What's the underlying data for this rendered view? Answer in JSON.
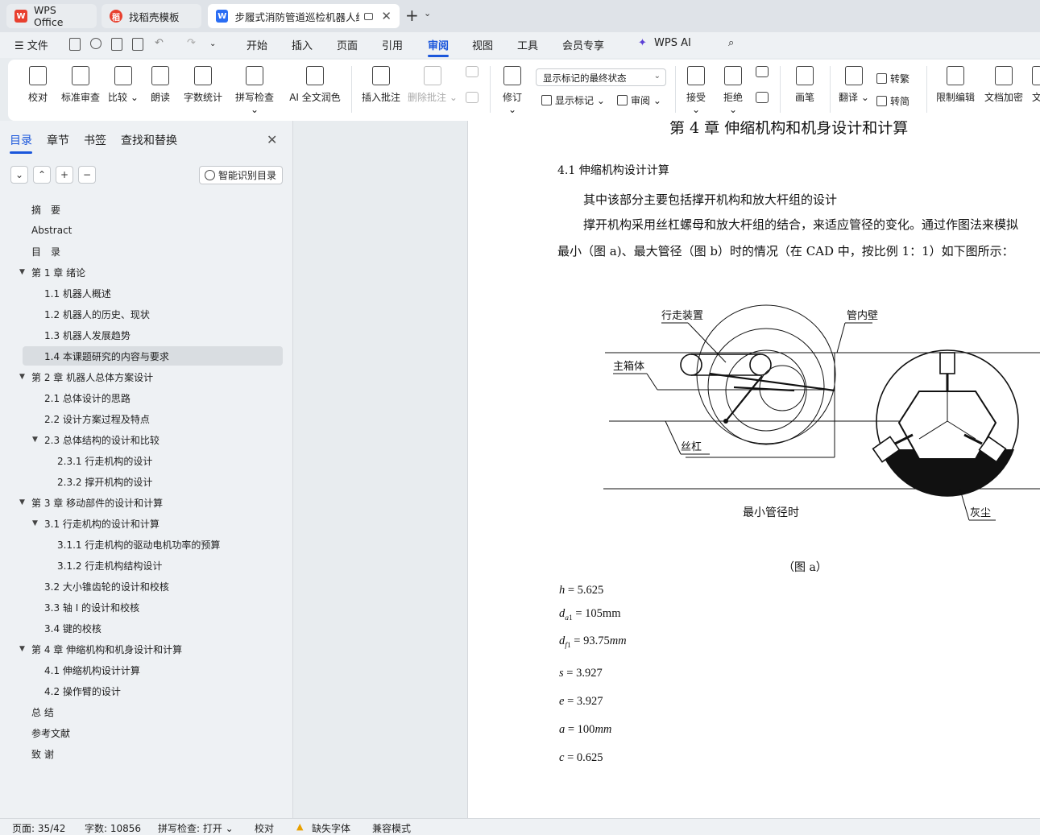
{
  "tabs": [
    {
      "label": "WPS Office"
    },
    {
      "label": "找稻壳模板"
    },
    {
      "label": "步履式消防管道巡检机器人结"
    }
  ],
  "menu": [
    "文件",
    "开始",
    "插入",
    "页面",
    "引用",
    "审阅",
    "视图",
    "工具",
    "会员专享",
    "WPS AI"
  ],
  "menu_active": "审阅",
  "ribbon": {
    "proof": "校对",
    "std_review": "标准审查",
    "compare": "比较",
    "read_aloud": "朗读",
    "word_count": "字数统计",
    "spell_check": "拼写检查",
    "ai_polish": "AI 全文润色",
    "insert_comment": "插入批注",
    "delete_comment": "删除批注",
    "revise": "修订",
    "markup_dropdown": "显示标记的最终状态",
    "show_markup": "显示标记",
    "review": "审阅",
    "accept": "接受",
    "reject": "拒绝",
    "pen": "画笔",
    "translate": "翻译",
    "to_traditional": "转繁",
    "to_simplified": "转简",
    "restrict_edit": "限制编辑",
    "doc_encrypt": "文档加密",
    "doc_cut": "文"
  },
  "sidebar": {
    "tabs": [
      "目录",
      "章节",
      "书签",
      "查找和替换"
    ],
    "smart_toc": "智能识别目录",
    "toc": [
      {
        "label": "摘　要",
        "level": 0
      },
      {
        "label": "Abstract",
        "level": 0
      },
      {
        "label": "目　录",
        "level": 0
      },
      {
        "label": "第 1 章  绪论",
        "level": 0,
        "expanded": true
      },
      {
        "label": "1.1  机器人概述",
        "level": 1
      },
      {
        "label": "1.2  机器人的历史、现状",
        "level": 1
      },
      {
        "label": "1.3 机器人发展趋势",
        "level": 1
      },
      {
        "label": "1.4  本课题研究的内容与要求",
        "level": 1,
        "selected": true
      },
      {
        "label": "第 2 章  机器人总体方案设计",
        "level": 0,
        "expanded": true
      },
      {
        "label": "2.1 总体设计的思路",
        "level": 1
      },
      {
        "label": "2.2  设计方案过程及特点",
        "level": 1
      },
      {
        "label": "2.3  总体结构的设计和比较",
        "level": 1,
        "expanded": true
      },
      {
        "label": "2.3.1  行走机构的设计",
        "level": 2
      },
      {
        "label": "2.3.2  撑开机构的设计",
        "level": 2
      },
      {
        "label": "第 3 章  移动部件的设计和计算",
        "level": 0,
        "expanded": true
      },
      {
        "label": "3.1  行走机构的设计和计算",
        "level": 1,
        "expanded": true
      },
      {
        "label": "3.1.1  行走机构的驱动电机功率的预算",
        "level": 2
      },
      {
        "label": "3.1.2  行走机构结构设计",
        "level": 2
      },
      {
        "label": "3.2 大小锥齿轮的设计和校核",
        "level": 1
      },
      {
        "label": "3.3  轴 I 的设计和校核",
        "level": 1
      },
      {
        "label": "3.4  键的校核",
        "level": 1
      },
      {
        "label": "第 4 章  伸缩机构和机身设计和计算",
        "level": 0,
        "expanded": true
      },
      {
        "label": "4.1  伸缩机构设计计算",
        "level": 1
      },
      {
        "label": "4.2  操作臂的设计",
        "level": 1
      },
      {
        "label": "总 结",
        "level": 0
      },
      {
        "label": "参考文献",
        "level": 0
      },
      {
        "label": "致 谢",
        "level": 0
      }
    ]
  },
  "document": {
    "chapter_title": "第 4 章  伸缩机构和机身设计和计算",
    "section_title": "4.1  伸缩机构设计计算",
    "para1": "其中该部分主要包括撑开机构和放大杆组的设计",
    "para2": "撑开机构采用丝杠螺母和放大杆组的结合，来适应管径的变化。通过作图法来模拟",
    "para3": "最小（图 a)、最大管径（图 b）时的情况（在 CAD 中，按比例 1：1）如下图所示：",
    "figure": {
      "label_walker": "行走装置",
      "label_pipe_wall": "管内壁",
      "label_main_box": "主箱体",
      "label_lead_screw": "丝杠",
      "label_min_diam": "最小管径时",
      "label_dust": "灰尘"
    },
    "figure_caption": "（图 a）",
    "formulas": {
      "h": "= 5.625",
      "da1": "= 105mm",
      "df1_val": "= 93.75",
      "df1_unit": "mm",
      "s": "= 3.927",
      "e": "= 3.927",
      "a_val": "= 100",
      "a_unit": "mm",
      "c": "= 0.625"
    }
  },
  "status": {
    "page": "页面: 35/42",
    "words": "字数: 10856",
    "spell": "拼写检查: 打开",
    "proof": "校对",
    "missing_font": "缺失字体",
    "compat": "兼容模式"
  },
  "colors": {
    "accent": "#1a56db",
    "wps_red": "#e8402f",
    "doc_blue": "#2a6df4"
  }
}
